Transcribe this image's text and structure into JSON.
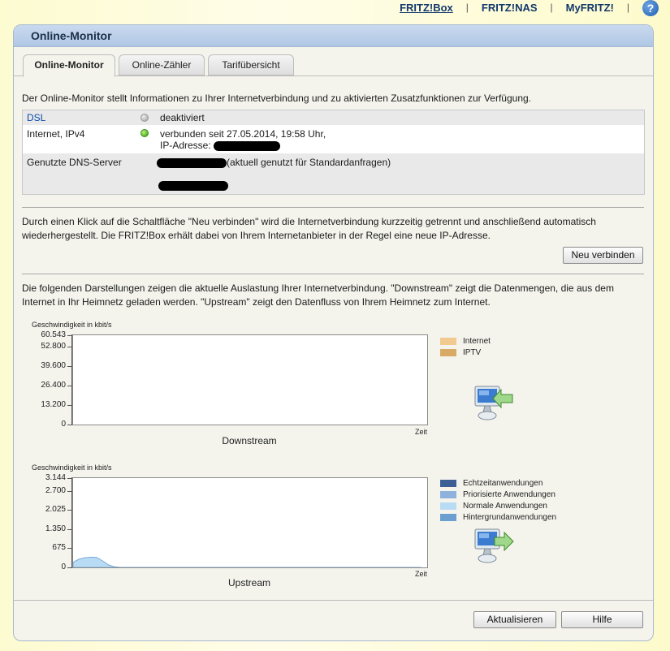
{
  "topnav": {
    "items": [
      "FRITZ!Box",
      "FRITZ!NAS",
      "MyFRITZ!"
    ],
    "active_index": 0,
    "help_label": "?"
  },
  "panel": {
    "title": "Online-Monitor"
  },
  "tabs": [
    "Online-Monitor",
    "Online-Zähler",
    "Tarifübersicht"
  ],
  "active_tab": 0,
  "intro": "Der Online-Monitor stellt Informationen zu Ihrer Internetverbindung und zu aktivierten Zusatzfunktionen zur Verfügung.",
  "status": {
    "dsl": {
      "label": "DSL",
      "state": "deaktiviert",
      "indicator": "grey"
    },
    "internet": {
      "label": "Internet, IPv4",
      "state": "verbunden seit 27.05.2014, 19:58 Uhr,",
      "ip_label": "IP-Adresse:",
      "indicator": "green"
    },
    "dns": {
      "label": "Genutzte DNS-Server",
      "note": "(aktuell genutzt für Standardanfragen)"
    }
  },
  "reconnect": {
    "text": "Durch einen Klick auf die Schaltfläche \"Neu verbinden\" wird die Internetverbindung kurzzeitig getrennt und anschließend automatisch wiederhergestellt. Die FRITZ!Box erhält dabei von Ihrem Internetanbieter in der Regel eine neue IP-Adresse.",
    "button": "Neu verbinden"
  },
  "charts_intro": "Die folgenden Darstellungen zeigen die aktuelle Auslastung Ihrer Internetverbindung. \"Downstream\" zeigt die Datenmengen, die aus dem Internet in Ihr Heimnetz geladen werden. \"Upstream\" zeigt den Datenfluss von Ihrem Heimnetz zum Internet.",
  "chart_data": [
    {
      "type": "area",
      "title": "Downstream",
      "ylabel": "Geschwindigkeit in kbit/s",
      "xlabel": "Zeit",
      "yticks": [
        "60.543",
        "52.800",
        "39.600",
        "26.400",
        "13.200",
        "0"
      ],
      "ytick_values": [
        60543,
        52800,
        39600,
        26400,
        13200,
        0
      ],
      "ylim": [
        0,
        60543
      ],
      "series": [
        {
          "name": "Internet",
          "color": "#f2c98f",
          "values": []
        },
        {
          "name": "IPTV",
          "color": "#d9aa66",
          "values": []
        }
      ],
      "direction_icon": "computer-download-icon"
    },
    {
      "type": "area",
      "title": "Upstream",
      "ylabel": "Geschwindigkeit in kbit/s",
      "xlabel": "Zeit",
      "yticks": [
        "3.144",
        "2.700",
        "2.025",
        "1.350",
        "675",
        "0"
      ],
      "ytick_values": [
        3144,
        2700,
        2025,
        1350,
        675,
        0
      ],
      "ylim": [
        0,
        3144
      ],
      "series": [
        {
          "name": "Echtzeitanwendungen",
          "color": "#3e5f96",
          "values": []
        },
        {
          "name": "Priorisierte Anwendungen",
          "color": "#8fb2dc",
          "values": []
        },
        {
          "name": "Normale Anwendungen",
          "color": "#b9dcf5",
          "values": [
            180,
            290,
            340,
            360,
            350,
            230,
            90,
            20,
            0,
            0,
            0,
            0,
            0,
            0,
            0,
            0,
            0,
            0,
            0,
            0,
            0,
            0,
            0,
            0,
            0,
            0,
            0,
            0,
            0,
            0,
            0,
            0,
            0,
            0,
            0,
            0,
            0,
            0,
            0,
            0,
            0,
            0,
            0,
            0,
            0,
            0,
            0,
            0,
            0,
            0,
            0,
            0,
            0,
            0,
            0,
            0,
            0,
            0,
            0,
            0
          ]
        },
        {
          "name": "Hintergrundanwendungen",
          "color": "#6c9ed0",
          "values": []
        }
      ],
      "direction_icon": "computer-upload-icon"
    }
  ],
  "footer": {
    "refresh_button": "Aktualisieren",
    "help_button": "Hilfe"
  }
}
